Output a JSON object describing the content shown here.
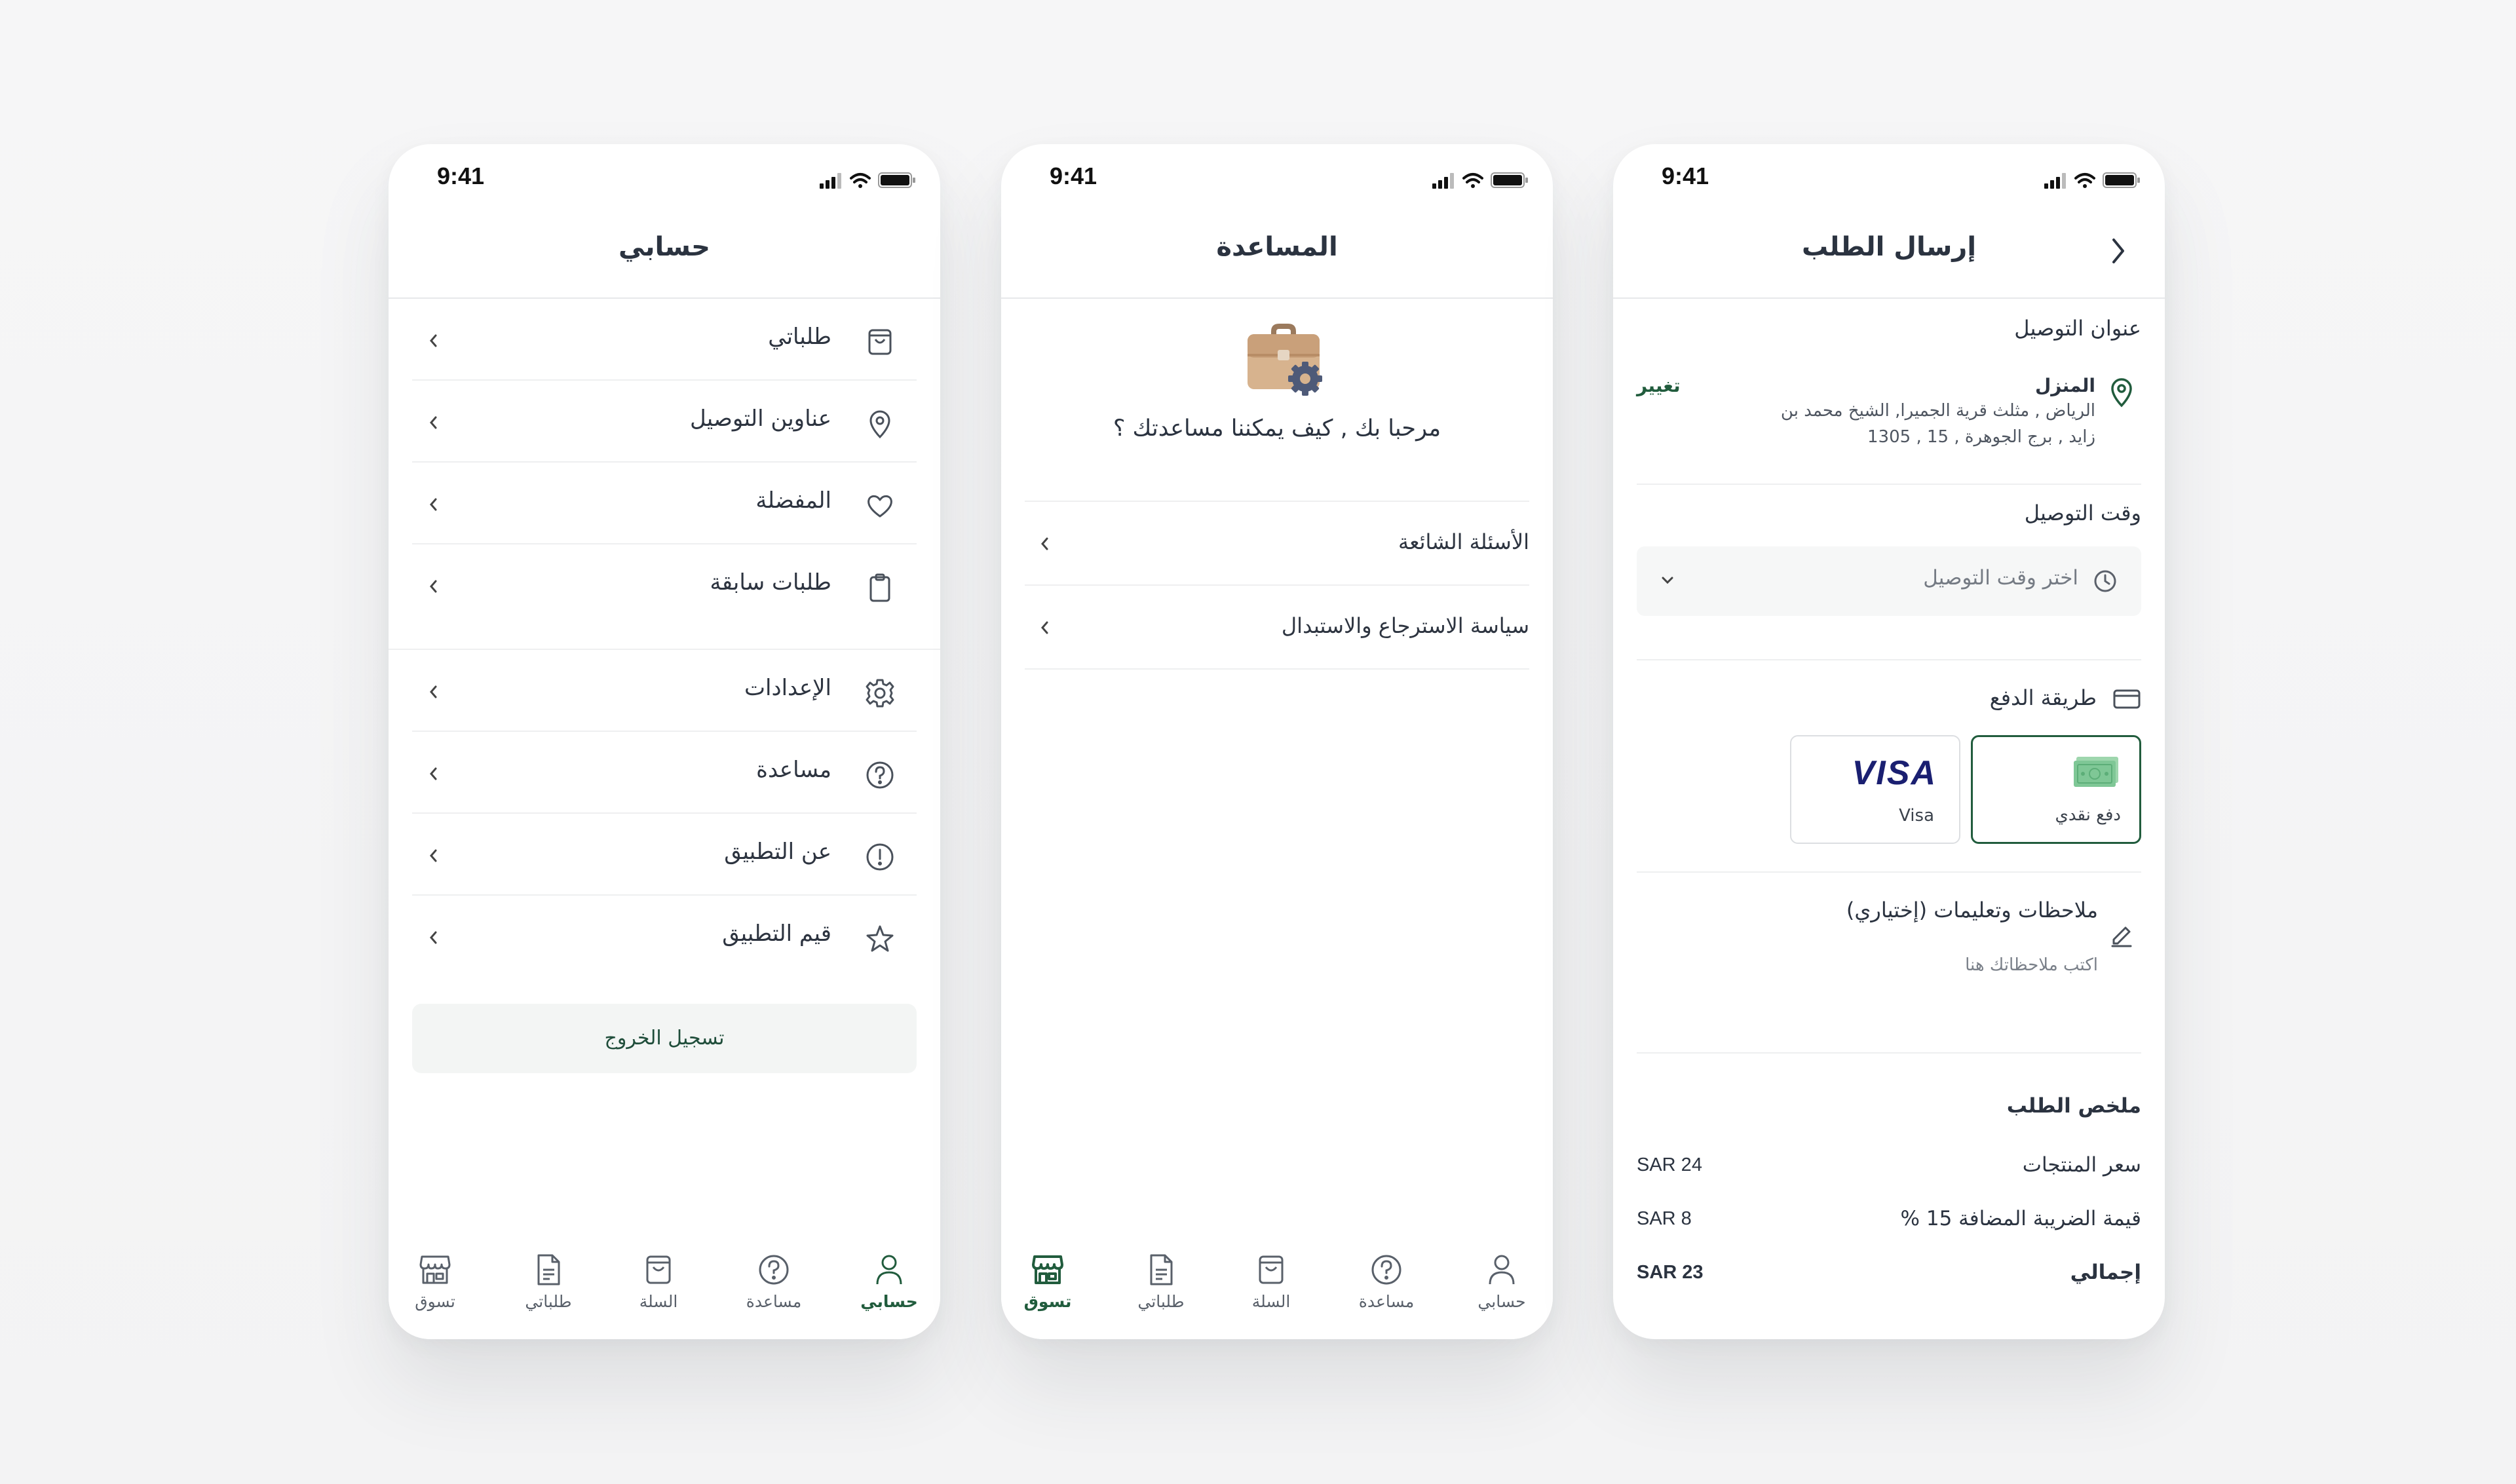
{
  "status": {
    "time": "9:41"
  },
  "tabs": {
    "account": "حسابي",
    "help": "مساعدة",
    "cart": "السلة",
    "orders": "طلباتي",
    "shop": "تسوق"
  },
  "account_screen": {
    "title": "حسابي",
    "items": [
      {
        "label": "طلباتي",
        "icon": "shopping-bag-icon"
      },
      {
        "label": "عناوين التوصيل",
        "icon": "location-pin-icon"
      },
      {
        "label": "المفضلة",
        "icon": "heart-icon"
      },
      {
        "label": "طلبات سابقة",
        "icon": "clipboard-icon"
      },
      {
        "label": "الإعدادات",
        "icon": "gear-icon"
      },
      {
        "label": "مساعدة",
        "icon": "help-circle-icon"
      },
      {
        "label": "عن التطبيق",
        "icon": "info-circle-icon"
      },
      {
        "label": "قيم التطبيق",
        "icon": "star-icon"
      }
    ],
    "logout": "تسجيل الخروج"
  },
  "help_screen": {
    "title": "المساعدة",
    "welcome": "مرحبا بك , كيف يمكننا مساعدتك ؟",
    "items": [
      {
        "label": "الأسئلة الشائعة"
      },
      {
        "label": "سياسة الاسترجاع والاستبدال"
      }
    ]
  },
  "checkout_screen": {
    "title": "إرسال الطلب",
    "address_section": "عنوان التوصيل",
    "address_name": "المنزل",
    "address_line1": "الرياض , مثلث قرية الجميرا, الشيخ محمد بن",
    "address_line2": "زايد , برج الجوهرة ,  15 ,   1305",
    "change": "تغيير",
    "time_section": "وقت التوصيل",
    "time_placeholder": "اختر وقت التوصيل",
    "payment_section": "طريقة الدفع",
    "payment_cash": "دفع نقدي",
    "payment_visa": "Visa",
    "visa_logo": "VISA",
    "notes_title": "ملاحظات وتعليمات (إختياري)",
    "notes_placeholder": "اكتب ملاحظاتك هنا",
    "summary_title": "ملخص الطلب",
    "summary": [
      {
        "label": "سعر المنتجات",
        "value": "SAR 24"
      },
      {
        "label": "قيمة الضريبة المضافة 15 %",
        "value": "SAR 8"
      },
      {
        "label": "إجمالي",
        "value": "SAR 23"
      }
    ]
  },
  "colors": {
    "accent": "#215c3d",
    "text": "#2b3340",
    "muted": "#757b84"
  }
}
